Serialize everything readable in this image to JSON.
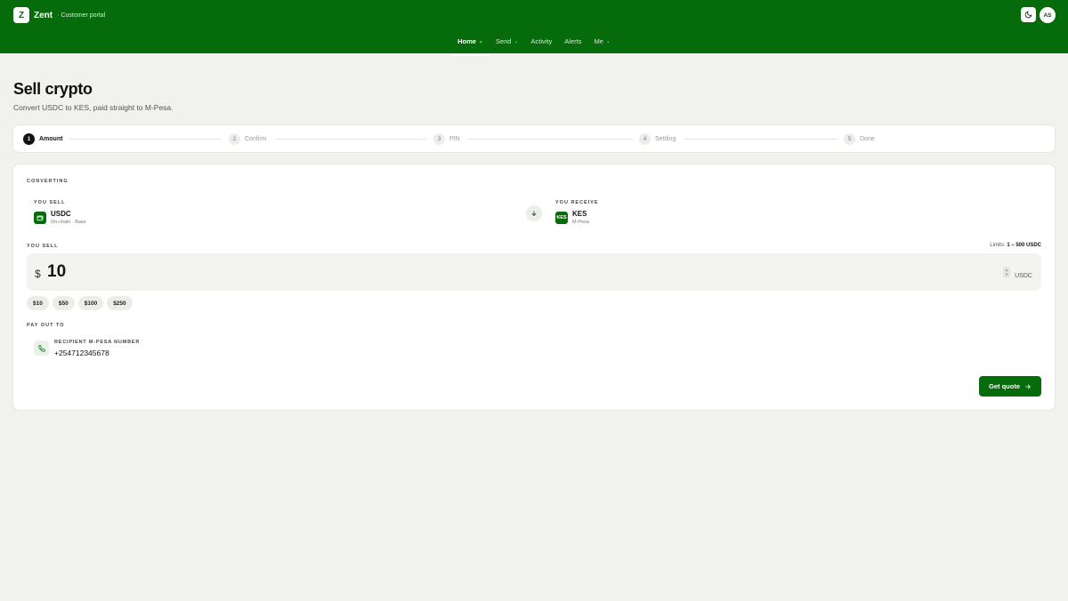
{
  "header": {
    "logo_letter": "Z",
    "brand": "Zent",
    "separator": "·",
    "subtitle": "Customer portal",
    "avatar_initials": "AS",
    "brand_color": "#056b0b"
  },
  "nav": {
    "items": [
      {
        "label": "Home",
        "active": true,
        "dropdown": true
      },
      {
        "label": "Send",
        "active": false,
        "dropdown": true
      },
      {
        "label": "Activity",
        "active": false,
        "dropdown": false
      },
      {
        "label": "Alerts",
        "active": false,
        "dropdown": false
      },
      {
        "label": "Me",
        "active": false,
        "dropdown": true
      }
    ]
  },
  "page": {
    "title": "Sell crypto",
    "subtitle": "Convert USDC to KES, paid straight to M-Pesa."
  },
  "stepper": {
    "steps": [
      {
        "num": "1",
        "label": "Amount",
        "active": true
      },
      {
        "num": "2",
        "label": "Confirm",
        "active": false
      },
      {
        "num": "3",
        "label": "PIN",
        "active": false
      },
      {
        "num": "4",
        "label": "Settling",
        "active": false
      },
      {
        "num": "5",
        "label": "Done",
        "active": false
      }
    ]
  },
  "converting": {
    "section_label": "CONVERTING",
    "sell_label": "YOU SELL",
    "sell_asset": "USDC",
    "sell_sub": "On-chain · Base",
    "receive_label": "YOU RECEIVE",
    "receive_icon_text": "KES",
    "receive_asset": "KES",
    "receive_sub": "M-Pesa"
  },
  "amount": {
    "label": "YOU SELL",
    "limits_prefix": "Limits:",
    "limits_value": "1 – 500 USDC",
    "currency_symbol": "$",
    "value": "10",
    "unit": "USDC",
    "presets": [
      "$10",
      "$50",
      "$100",
      "$250"
    ]
  },
  "payout": {
    "section_label": "PAY OUT TO",
    "recipient_label": "RECIPIENT M-PESA NUMBER",
    "recipient_value": "+254712345678"
  },
  "actions": {
    "quote_label": "Get quote"
  }
}
